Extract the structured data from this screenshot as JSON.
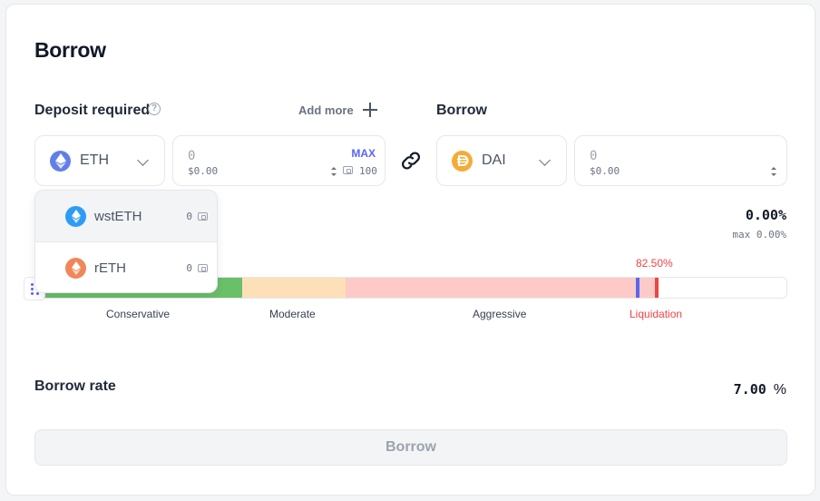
{
  "title": "Borrow",
  "deposit": {
    "label": "Deposit required",
    "help_icon": "question-circle-icon",
    "add_more": "Add more",
    "asset": "ETH",
    "amount_placeholder": "0",
    "usd": "$0.00",
    "max_label": "MAX",
    "balance": "100",
    "accent": "#5865f2"
  },
  "borrow": {
    "label": "Borrow",
    "asset": "DAI",
    "amount_placeholder": "0",
    "usd": "$0.00"
  },
  "dropdown": {
    "items": [
      {
        "name": "wstETH",
        "balance": "0",
        "icon": "wsteth-coin-icon",
        "color": "#2e9cf4"
      },
      {
        "name": "rETH",
        "balance": "0",
        "icon": "reth-coin-icon",
        "color": "#f0875a"
      }
    ]
  },
  "ltv": {
    "value": "0.00%",
    "max": "max 0.00%",
    "liquidation_pct": "82.50%",
    "ticks": [
      "Conservative",
      "Moderate",
      "Aggressive",
      "Liquidation"
    ],
    "colors": {
      "conservative": "#6abf69",
      "moderate": "#fde0b8",
      "aggressive": "#fdcac7",
      "marker": "#5865f2",
      "liquidation": "#ef4444"
    }
  },
  "borrow_rate": {
    "label": "Borrow rate",
    "value": "7.00",
    "unit": "%"
  },
  "submit": {
    "label": "Borrow"
  }
}
